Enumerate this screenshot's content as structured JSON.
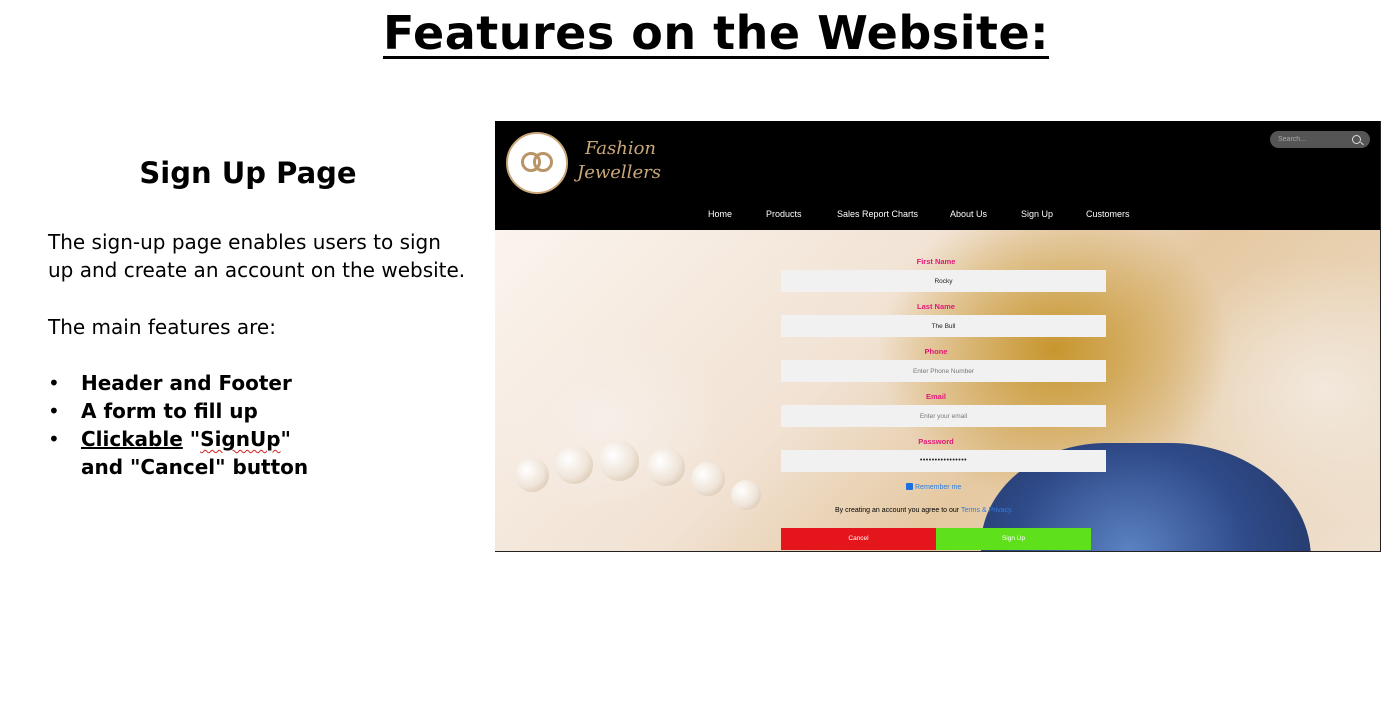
{
  "slide": {
    "title": "Features on the Website:",
    "section_title": "Sign Up Page",
    "paragraph_1": "The sign-up page enables users to sign up and create an account on the website.",
    "paragraph_2": "The main features are:",
    "bullets": {
      "b1": "Header and Footer",
      "b2": "A form to fill up",
      "b3_part1": "Clickable",
      "b3_part2": " \"",
      "b3_part3": "SignUp",
      "b3_part4": "\"",
      "b3_line2": "and  \"Cancel\"  button"
    }
  },
  "website": {
    "brand": {
      "line1": "Fashion",
      "line2": "Jewellers"
    },
    "search": {
      "placeholder": "Search...",
      "icon": "search-icon"
    },
    "nav": {
      "home": "Home",
      "products": "Products",
      "sales": "Sales Report Charts",
      "about": "About Us",
      "signup": "Sign Up",
      "customers": "Customers"
    },
    "form": {
      "first_name_label": "First Name",
      "first_name_value": "Rocky",
      "last_name_label": "Last Name",
      "last_name_value": "The Bull",
      "phone_label": "Phone",
      "phone_placeholder": "Enter Phone Number",
      "email_label": "Email",
      "email_placeholder": "Enter your email",
      "password_label": "Password",
      "password_value": "••••••••••••••••",
      "remember_label": "Remember me",
      "terms_text": "By creating an account you agree to our ",
      "terms_link": "Terms & Privacy.",
      "cancel_label": "Cancel",
      "signup_label": "Sign Up"
    },
    "colors": {
      "header_bg": "#000000",
      "label_color": "#e0177a",
      "cancel_bg": "#e4161b",
      "signup_bg": "#5ee01a",
      "brand_gold": "#c9a77a"
    }
  }
}
